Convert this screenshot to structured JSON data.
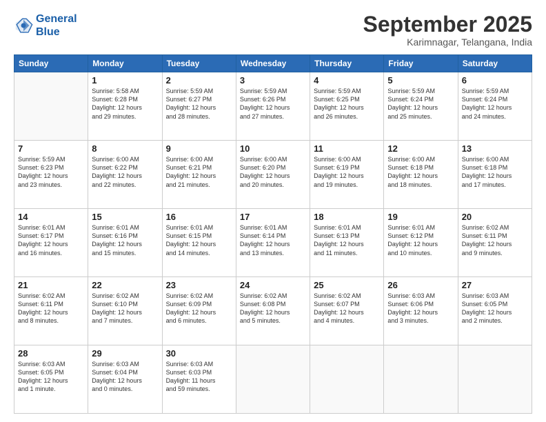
{
  "logo": {
    "line1": "General",
    "line2": "Blue"
  },
  "title": "September 2025",
  "subtitle": "Karimnagar, Telangana, India",
  "weekdays": [
    "Sunday",
    "Monday",
    "Tuesday",
    "Wednesday",
    "Thursday",
    "Friday",
    "Saturday"
  ],
  "weeks": [
    [
      {
        "day": "",
        "info": ""
      },
      {
        "day": "1",
        "info": "Sunrise: 5:58 AM\nSunset: 6:28 PM\nDaylight: 12 hours\nand 29 minutes."
      },
      {
        "day": "2",
        "info": "Sunrise: 5:59 AM\nSunset: 6:27 PM\nDaylight: 12 hours\nand 28 minutes."
      },
      {
        "day": "3",
        "info": "Sunrise: 5:59 AM\nSunset: 6:26 PM\nDaylight: 12 hours\nand 27 minutes."
      },
      {
        "day": "4",
        "info": "Sunrise: 5:59 AM\nSunset: 6:25 PM\nDaylight: 12 hours\nand 26 minutes."
      },
      {
        "day": "5",
        "info": "Sunrise: 5:59 AM\nSunset: 6:24 PM\nDaylight: 12 hours\nand 25 minutes."
      },
      {
        "day": "6",
        "info": "Sunrise: 5:59 AM\nSunset: 6:24 PM\nDaylight: 12 hours\nand 24 minutes."
      }
    ],
    [
      {
        "day": "7",
        "info": "Sunrise: 5:59 AM\nSunset: 6:23 PM\nDaylight: 12 hours\nand 23 minutes."
      },
      {
        "day": "8",
        "info": "Sunrise: 6:00 AM\nSunset: 6:22 PM\nDaylight: 12 hours\nand 22 minutes."
      },
      {
        "day": "9",
        "info": "Sunrise: 6:00 AM\nSunset: 6:21 PM\nDaylight: 12 hours\nand 21 minutes."
      },
      {
        "day": "10",
        "info": "Sunrise: 6:00 AM\nSunset: 6:20 PM\nDaylight: 12 hours\nand 20 minutes."
      },
      {
        "day": "11",
        "info": "Sunrise: 6:00 AM\nSunset: 6:19 PM\nDaylight: 12 hours\nand 19 minutes."
      },
      {
        "day": "12",
        "info": "Sunrise: 6:00 AM\nSunset: 6:18 PM\nDaylight: 12 hours\nand 18 minutes."
      },
      {
        "day": "13",
        "info": "Sunrise: 6:00 AM\nSunset: 6:18 PM\nDaylight: 12 hours\nand 17 minutes."
      }
    ],
    [
      {
        "day": "14",
        "info": "Sunrise: 6:01 AM\nSunset: 6:17 PM\nDaylight: 12 hours\nand 16 minutes."
      },
      {
        "day": "15",
        "info": "Sunrise: 6:01 AM\nSunset: 6:16 PM\nDaylight: 12 hours\nand 15 minutes."
      },
      {
        "day": "16",
        "info": "Sunrise: 6:01 AM\nSunset: 6:15 PM\nDaylight: 12 hours\nand 14 minutes."
      },
      {
        "day": "17",
        "info": "Sunrise: 6:01 AM\nSunset: 6:14 PM\nDaylight: 12 hours\nand 13 minutes."
      },
      {
        "day": "18",
        "info": "Sunrise: 6:01 AM\nSunset: 6:13 PM\nDaylight: 12 hours\nand 11 minutes."
      },
      {
        "day": "19",
        "info": "Sunrise: 6:01 AM\nSunset: 6:12 PM\nDaylight: 12 hours\nand 10 minutes."
      },
      {
        "day": "20",
        "info": "Sunrise: 6:02 AM\nSunset: 6:11 PM\nDaylight: 12 hours\nand 9 minutes."
      }
    ],
    [
      {
        "day": "21",
        "info": "Sunrise: 6:02 AM\nSunset: 6:11 PM\nDaylight: 12 hours\nand 8 minutes."
      },
      {
        "day": "22",
        "info": "Sunrise: 6:02 AM\nSunset: 6:10 PM\nDaylight: 12 hours\nand 7 minutes."
      },
      {
        "day": "23",
        "info": "Sunrise: 6:02 AM\nSunset: 6:09 PM\nDaylight: 12 hours\nand 6 minutes."
      },
      {
        "day": "24",
        "info": "Sunrise: 6:02 AM\nSunset: 6:08 PM\nDaylight: 12 hours\nand 5 minutes."
      },
      {
        "day": "25",
        "info": "Sunrise: 6:02 AM\nSunset: 6:07 PM\nDaylight: 12 hours\nand 4 minutes."
      },
      {
        "day": "26",
        "info": "Sunrise: 6:03 AM\nSunset: 6:06 PM\nDaylight: 12 hours\nand 3 minutes."
      },
      {
        "day": "27",
        "info": "Sunrise: 6:03 AM\nSunset: 6:05 PM\nDaylight: 12 hours\nand 2 minutes."
      }
    ],
    [
      {
        "day": "28",
        "info": "Sunrise: 6:03 AM\nSunset: 6:05 PM\nDaylight: 12 hours\nand 1 minute."
      },
      {
        "day": "29",
        "info": "Sunrise: 6:03 AM\nSunset: 6:04 PM\nDaylight: 12 hours\nand 0 minutes."
      },
      {
        "day": "30",
        "info": "Sunrise: 6:03 AM\nSunset: 6:03 PM\nDaylight: 11 hours\nand 59 minutes."
      },
      {
        "day": "",
        "info": ""
      },
      {
        "day": "",
        "info": ""
      },
      {
        "day": "",
        "info": ""
      },
      {
        "day": "",
        "info": ""
      }
    ]
  ]
}
